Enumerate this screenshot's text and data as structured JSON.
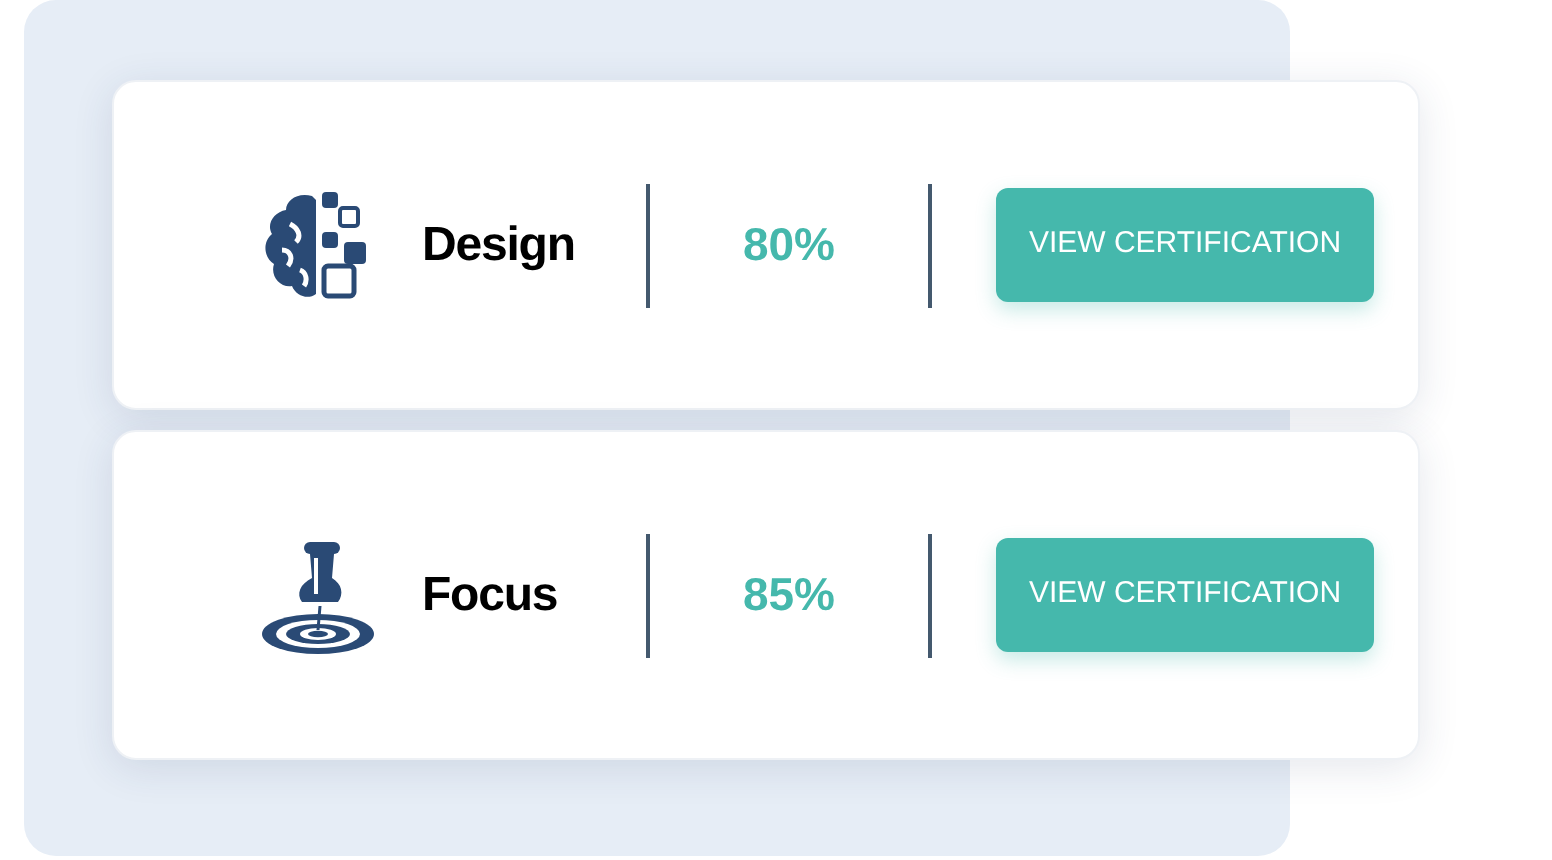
{
  "skills": [
    {
      "kind": "brain",
      "name": "Design",
      "percent": "80%",
      "button": "VIEW CERTIFICATION"
    },
    {
      "kind": "pin",
      "name": "Focus",
      "percent": "85%",
      "button": "VIEW CERTIFICATION"
    }
  ]
}
